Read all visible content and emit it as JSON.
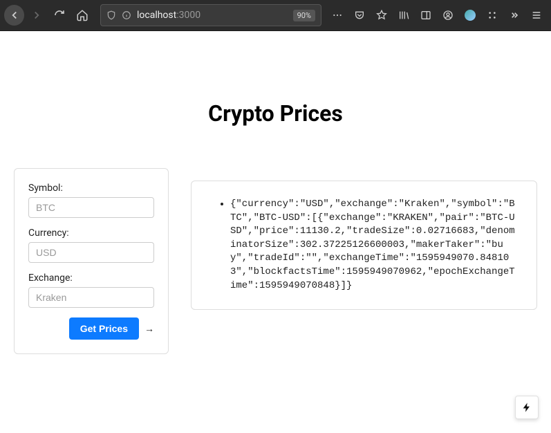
{
  "browser": {
    "url_host": "localhost",
    "url_port": ":3000",
    "zoom": "90%"
  },
  "page": {
    "title": "Crypto Prices"
  },
  "form": {
    "symbol_label": "Symbol:",
    "symbol_placeholder": "BTC",
    "currency_label": "Currency:",
    "currency_placeholder": "USD",
    "exchange_label": "Exchange:",
    "exchange_placeholder": "Kraken",
    "submit_label": "Get Prices",
    "arrow_glyph": "→"
  },
  "result": {
    "json_text": "{\"currency\":\"USD\",\"exchange\":\"Kraken\",\"symbol\":\"BTC\",\"BTC-USD\":[{\"exchange\":\"KRAKEN\",\"pair\":\"BTC-USD\",\"price\":11130.2,\"tradeSize\":0.02716683,\"denominatorSize\":302.37225126600003,\"makerTaker\":\"buy\",\"tradeId\":\"\",\"exchangeTime\":\"1595949070.848103\",\"blockfactsTime\":1595949070962,\"epochExchangeTime\":1595949070848}]}"
  }
}
